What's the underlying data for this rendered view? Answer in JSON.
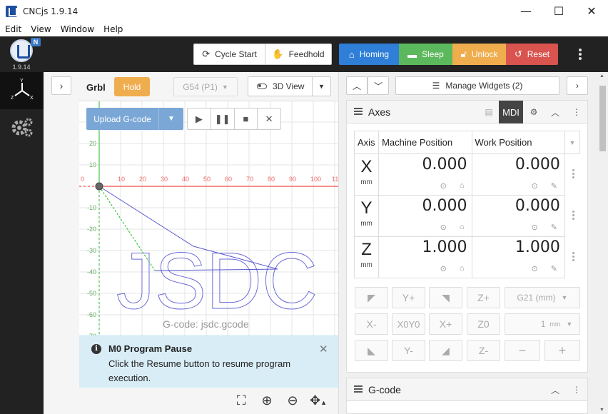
{
  "window": {
    "title": "CNCjs 1.9.14",
    "minimize": "—",
    "maximize": "☐",
    "close": "✕"
  },
  "menu": [
    "Edit",
    "View",
    "Window",
    "Help"
  ],
  "header": {
    "logo_badge": "N",
    "version": "1.9.14",
    "cycle_start": "Cycle Start",
    "feedhold": "Feedhold",
    "homing": "Homing",
    "sleep": "Sleep",
    "unlock": "Unlock",
    "reset": "Reset"
  },
  "visualizer": {
    "controller": "Grbl",
    "state": "Hold",
    "wcs": "G54 (P1)",
    "view_mode": "3D View",
    "upload": "Upload G-code",
    "gcode_name": "G-code: jsdc.gcode",
    "x_ticks": [
      "0",
      "10",
      "20",
      "30",
      "40",
      "50",
      "60",
      "70",
      "80",
      "90",
      "100",
      "110"
    ],
    "y_ticks": [
      "20",
      "10",
      "-10",
      "-20",
      "-30",
      "-40",
      "-50",
      "-60",
      "-70"
    ],
    "logo_text": "JSDC"
  },
  "notice": {
    "title": "M0 Program Pause",
    "message": "Click the Resume button to resume program execution."
  },
  "widgets": {
    "manage": "Manage Widgets (2)",
    "axes_title": "Axes",
    "mdi": "MDI",
    "gcode_title": "G-code"
  },
  "axes": {
    "headers": [
      "Axis",
      "Machine Position",
      "Work Position"
    ],
    "unit": "mm",
    "rows": [
      {
        "axis": "X",
        "machine": "0.000",
        "work": "0.000"
      },
      {
        "axis": "Y",
        "machine": "0.000",
        "work": "0.000"
      },
      {
        "axis": "Z",
        "machine": "1.000",
        "work": "1.000"
      }
    ]
  },
  "jog": {
    "y_plus": "Y+",
    "z_plus": "Z+",
    "units": "G21 (mm)",
    "x_minus": "X-",
    "x0y0": "X0Y0",
    "x_plus": "X+",
    "z0": "Z0",
    "step": "1",
    "step_unit": "mm",
    "y_minus": "Y-",
    "z_minus": "Z-",
    "minus": "−",
    "plus": "+"
  }
}
